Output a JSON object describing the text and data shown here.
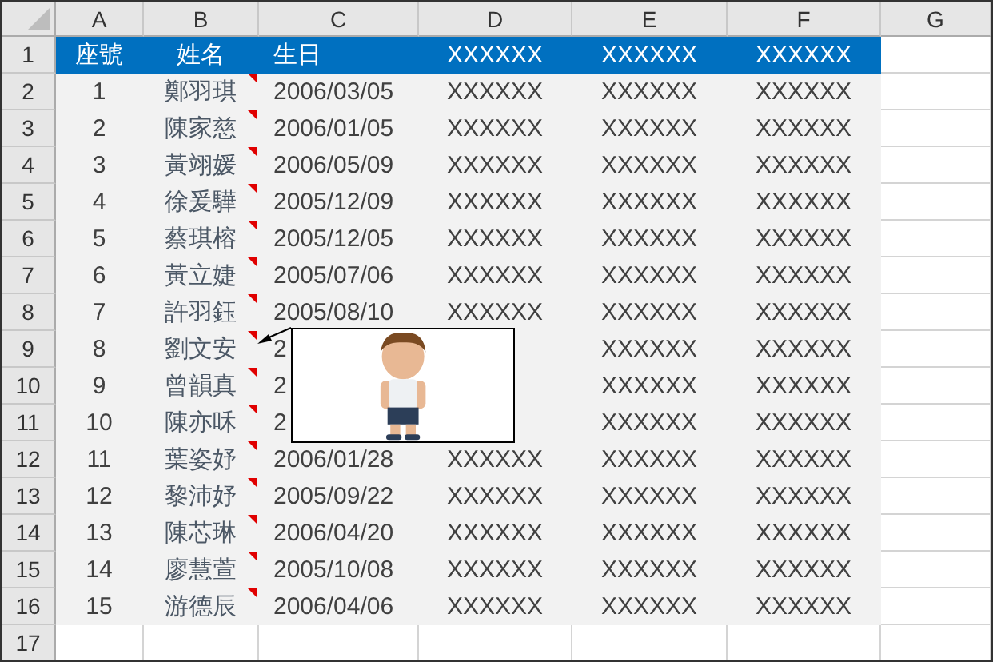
{
  "columns": [
    "A",
    "B",
    "C",
    "D",
    "E",
    "F",
    "G"
  ],
  "row_numbers": [
    "1",
    "2",
    "3",
    "4",
    "5",
    "6",
    "7",
    "8",
    "9",
    "10",
    "11",
    "12",
    "13",
    "14",
    "15",
    "16",
    "17"
  ],
  "header": [
    "座號",
    "姓名",
    "生日",
    "XXXXXX",
    "XXXXXX",
    "XXXXXX"
  ],
  "rows": [
    {
      "cells": [
        "1",
        "鄭羽琪",
        "2006/03/05",
        "XXXXXX",
        "XXXXXX",
        "XXXXXX"
      ],
      "comment": true
    },
    {
      "cells": [
        "2",
        "陳家慈",
        "2006/01/05",
        "XXXXXX",
        "XXXXXX",
        "XXXXXX"
      ],
      "comment": true
    },
    {
      "cells": [
        "3",
        "黃翊媛",
        "2006/05/09",
        "XXXXXX",
        "XXXXXX",
        "XXXXXX"
      ],
      "comment": true
    },
    {
      "cells": [
        "4",
        "徐爰驊",
        "2005/12/09",
        "XXXXXX",
        "XXXXXX",
        "XXXXXX"
      ],
      "comment": true
    },
    {
      "cells": [
        "5",
        "蔡琪榕",
        "2005/12/05",
        "XXXXXX",
        "XXXXXX",
        "XXXXXX"
      ],
      "comment": true
    },
    {
      "cells": [
        "6",
        "黃立婕",
        "2005/07/06",
        "XXXXXX",
        "XXXXXX",
        "XXXXXX"
      ],
      "comment": true
    },
    {
      "cells": [
        "7",
        "許羽鈺",
        "2005/08/10",
        "XXXXXX",
        "XXXXXX",
        "XXXXXX"
      ],
      "comment": true
    },
    {
      "cells": [
        "8",
        "劉文安",
        "2",
        null,
        "XXXXXX",
        "XXXXXX"
      ],
      "comment": true
    },
    {
      "cells": [
        "9",
        "曾韻真",
        "2",
        null,
        "XXXXXX",
        "XXXXXX"
      ],
      "comment": true
    },
    {
      "cells": [
        "10",
        "陳亦咊",
        "2",
        null,
        "XXXXXX",
        "XXXXXX"
      ],
      "comment": true
    },
    {
      "cells": [
        "11",
        "葉姿妤",
        "2006/01/28",
        "XXXXXX",
        "XXXXXX",
        "XXXXXX"
      ],
      "comment": true
    },
    {
      "cells": [
        "12",
        "黎沛妤",
        "2005/09/22",
        "XXXXXX",
        "XXXXXX",
        "XXXXXX"
      ],
      "comment": true
    },
    {
      "cells": [
        "13",
        "陳芯琳",
        "2006/04/20",
        "XXXXXX",
        "XXXXXX",
        "XXXXXX"
      ],
      "comment": true
    },
    {
      "cells": [
        "14",
        "廖慧萱",
        "2005/10/08",
        "XXXXXX",
        "XXXXXX",
        "XXXXXX"
      ],
      "comment": true
    },
    {
      "cells": [
        "15",
        "游德辰",
        "2006/04/06",
        "XXXXXX",
        "XXXXXX",
        "XXXXXX"
      ],
      "comment": true
    }
  ],
  "comment_box": {
    "kind": "picture"
  }
}
